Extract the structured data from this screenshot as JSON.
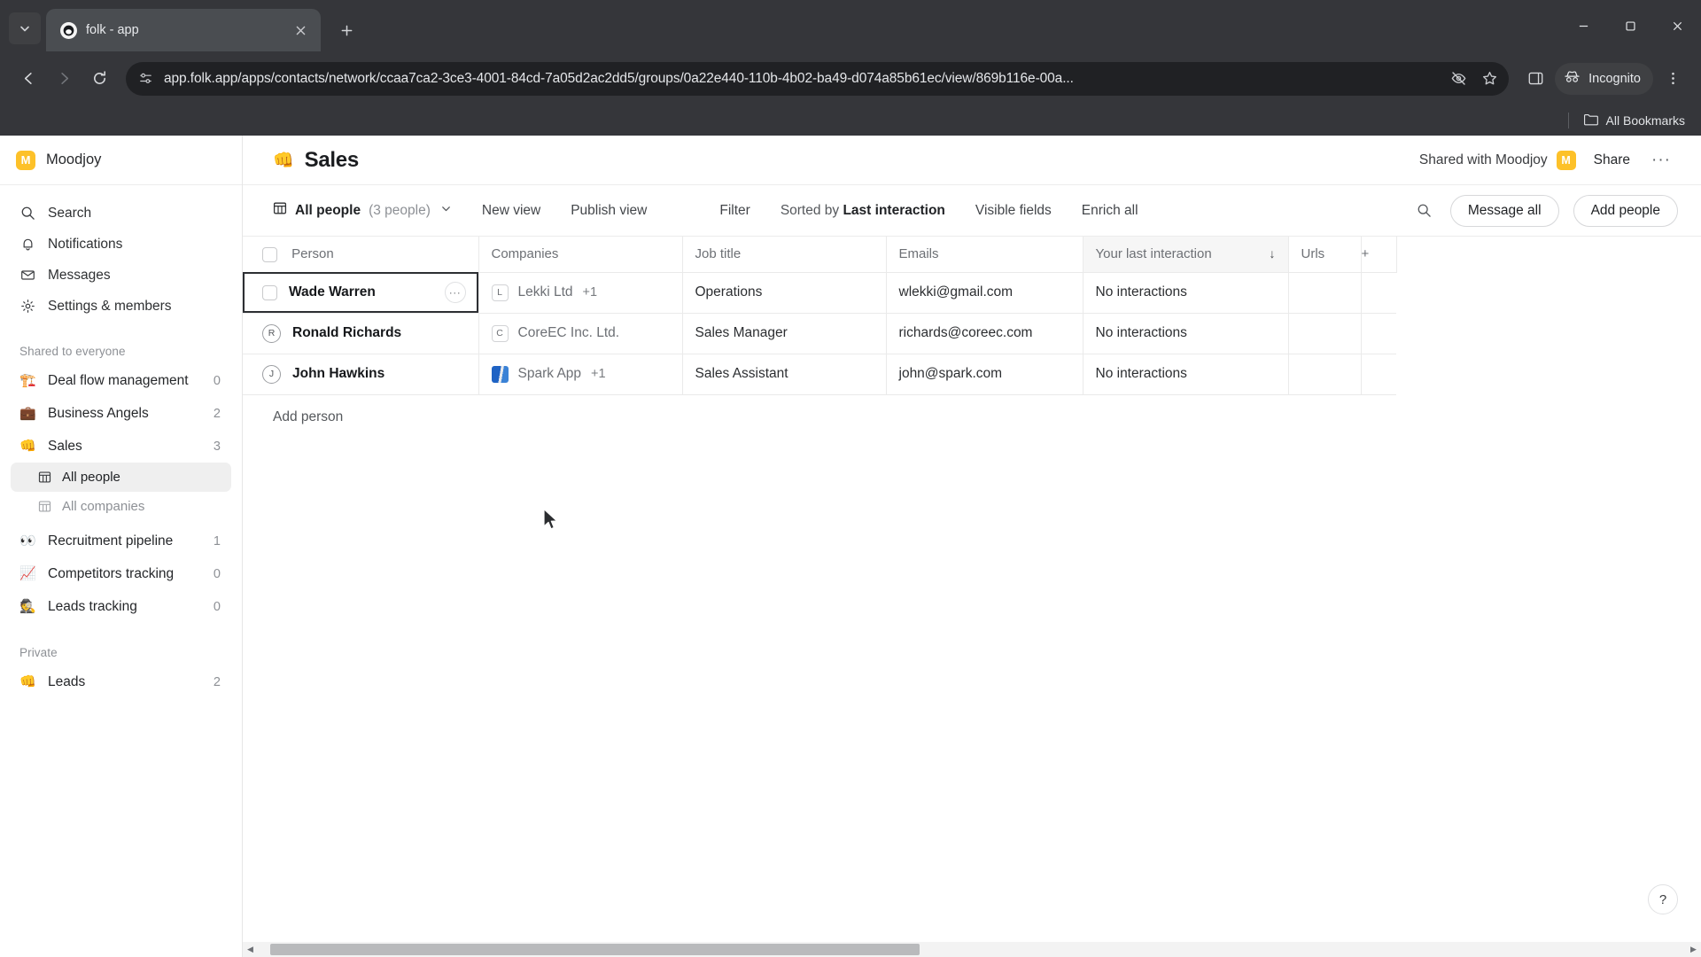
{
  "browser": {
    "tab": {
      "title": "folk - app",
      "favicon_icon": "folk-logo-icon",
      "close_icon": "close-icon"
    },
    "tab_search_icon": "chevron-down-icon",
    "new_tab_icon": "plus-icon",
    "window_controls": {
      "minimize": "–",
      "maximize": "⬜",
      "close": "✕"
    },
    "nav": {
      "back_icon": "arrow-left-icon",
      "forward_icon": "arrow-right-icon",
      "reload_icon": "reload-icon"
    },
    "url": "app.folk.app/apps/contacts/network/ccaa7ca2-3ce3-4001-84cd-7a05d2ac2dd5/groups/0a22e440-110b-4b02-ba49-d074a85b61ec/view/869b116e-00a...",
    "site_info_icon": "tune-icon",
    "tracking_icon": "eye-off-icon",
    "bookmark_icon": "star-icon",
    "sidepanel_icon": "side-panel-icon",
    "incognito_label": "Incognito",
    "incognito_icon": "incognito-icon",
    "bookmarks_label": "All Bookmarks",
    "bookmarks_icon": "folder-icon"
  },
  "sidebar": {
    "workspace": {
      "name": "Moodjoy",
      "avatar_letter": "M",
      "avatar_color": "#fdc129"
    },
    "nav": [
      {
        "label": "Search",
        "icon": "search-icon"
      },
      {
        "label": "Notifications",
        "icon": "bell-icon"
      },
      {
        "label": "Messages",
        "icon": "mail-icon"
      },
      {
        "label": "Settings & members",
        "icon": "gear-icon"
      }
    ],
    "shared_section_label": "Shared to everyone",
    "groups": [
      {
        "label": "Deal flow management",
        "emoji": "🏗️",
        "count": "0"
      },
      {
        "label": "Business Angels",
        "emoji": "💼",
        "count": "2"
      },
      {
        "label": "Sales",
        "emoji": "👊",
        "count": "3",
        "active": true
      }
    ],
    "sales_subviews": [
      {
        "label": "All people",
        "icon": "table-icon",
        "active": true
      },
      {
        "label": "All companies",
        "icon": "table-icon",
        "active": false
      }
    ],
    "groups_after": [
      {
        "label": "Recruitment pipeline",
        "emoji": "👀",
        "count": "1"
      },
      {
        "label": "Competitors tracking",
        "emoji": "📈",
        "count": "0"
      },
      {
        "label": "Leads tracking",
        "emoji": "🕵️",
        "count": "0"
      }
    ],
    "private_section_label": "Private",
    "private_groups": [
      {
        "label": "Leads",
        "emoji": "👊",
        "count": "2"
      }
    ]
  },
  "header": {
    "emoji": "👊",
    "title": "Sales",
    "shared_with_label": "Shared with Moodjoy",
    "shared_avatar_letter": "M",
    "share_label": "Share",
    "more_label": "···"
  },
  "toolbar": {
    "view_icon": "table-icon",
    "view_name": "All people",
    "view_count": "(3 people)",
    "view_chevron": "⌄",
    "new_view": "New view",
    "publish_view": "Publish view",
    "filter": "Filter",
    "sorted_by_prefix": "Sorted by ",
    "sorted_by_field": "Last interaction",
    "visible_fields": "Visible fields",
    "enrich_all": "Enrich all",
    "search_icon": "search-icon",
    "message_all": "Message all",
    "add_people": "Add people"
  },
  "table": {
    "columns": [
      {
        "label": "Person",
        "key": "person"
      },
      {
        "label": "Companies",
        "key": "companies"
      },
      {
        "label": "Job title",
        "key": "job"
      },
      {
        "label": "Emails",
        "key": "emails"
      },
      {
        "label": "Your last interaction",
        "key": "last",
        "sorted": true,
        "sort_icon": "↓"
      },
      {
        "label": "Urls",
        "key": "urls"
      }
    ],
    "add_column_icon": "plus-icon",
    "rows": [
      {
        "person": "Wade Warren",
        "avatar_type": "checkbox",
        "avatar_letter": "",
        "selected": true,
        "row_menu": "···",
        "company": "Lekki Ltd",
        "company_logo_letter": "L",
        "company_logo_type": "letter",
        "company_extra": "+1",
        "job": "Operations",
        "email": "wlekki@gmail.com",
        "last": "No interactions",
        "urls": ""
      },
      {
        "person": "Ronald Richards",
        "avatar_type": "letter",
        "avatar_letter": "R",
        "selected": false,
        "company": "CoreEC Inc. Ltd.",
        "company_logo_letter": "C",
        "company_logo_type": "letter",
        "company_extra": "",
        "job": "Sales Manager",
        "email": "richards@coreec.com",
        "last": "No interactions",
        "urls": ""
      },
      {
        "person": "John Hawkins",
        "avatar_type": "letter",
        "avatar_letter": "J",
        "selected": false,
        "company": "Spark App",
        "company_logo_letter": "",
        "company_logo_type": "image",
        "company_extra": "+1",
        "job": "Sales Assistant",
        "email": "john@spark.com",
        "last": "No interactions",
        "urls": ""
      }
    ],
    "add_person_label": "Add person"
  },
  "footer": {
    "help_label": "?",
    "scroll_left_icon": "◀",
    "scroll_right_icon": "▶"
  }
}
